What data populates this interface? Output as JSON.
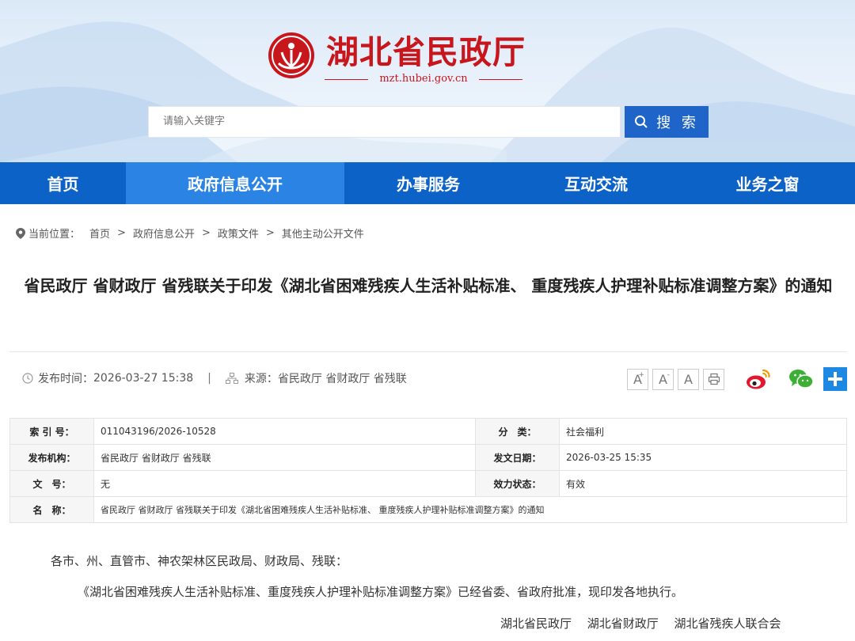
{
  "header": {
    "site_name": "湖北省民政厅",
    "domain": "mzt.hubei.gov.cn",
    "search_placeholder": "请输入关键字",
    "search_button": "搜 索"
  },
  "nav": {
    "items": [
      {
        "label": "首页"
      },
      {
        "label": "政府信息公开"
      },
      {
        "label": "办事服务"
      },
      {
        "label": "互动交流"
      },
      {
        "label": "业务之窗"
      }
    ]
  },
  "breadcrumb": {
    "label": "当前位置：",
    "items": [
      "首页",
      "政府信息公开",
      "政策文件",
      "其他主动公开文件"
    ],
    "sep": ">"
  },
  "article": {
    "title": "省民政厅 省财政厅 省残联关于印发《湖北省困难残疾人生活补贴标准、 重度残疾人护理补贴标准调整方案》的通知",
    "publish_label": "发布时间：",
    "publish_time": "2026-03-27 15:38",
    "divider": "|",
    "source_label": "来源：",
    "source": "省民政厅 省财政厅 省残联"
  },
  "tools": {
    "font_large": "A",
    "font_small": "A",
    "font_normal": "A",
    "plus_sup": "+",
    "minus_sup": "-"
  },
  "info": {
    "index_label": "索 引 号：",
    "index_value": "011043196/2026-10528",
    "category_label": "分　类：",
    "category_value": "社会福利",
    "issuer_label": "发布机构：",
    "issuer_value": "省民政厅 省财政厅 省残联",
    "date_label": "发文日期：",
    "date_value": "2026-03-25 15:35",
    "docno_label": "文　号：",
    "docno_value": "无",
    "status_label": "效力状态：",
    "status_value": "有效",
    "name_label": "名　称：",
    "name_value": "省民政厅 省财政厅 省残联关于印发《湖北省困难残疾人生活补贴标准、 重度残疾人护理补贴标准调整方案》的通知"
  },
  "body": {
    "salutation": "各市、州、直管市、神农架林区民政局、财政局、残联：",
    "paragraph1": "《湖北省困难残疾人生活补贴标准、重度残疾人护理补贴标准调整方案》已经省委、省政府批准，现印发各地执行。",
    "signature": "湖北省民政厅　 湖北省财政厅　 湖北省残疾人联合会"
  },
  "colors": {
    "brand_red": "#c8161d",
    "nav_blue": "#0d62c7",
    "nav_active": "#2b84e4",
    "search_blue": "#1f64c9"
  }
}
